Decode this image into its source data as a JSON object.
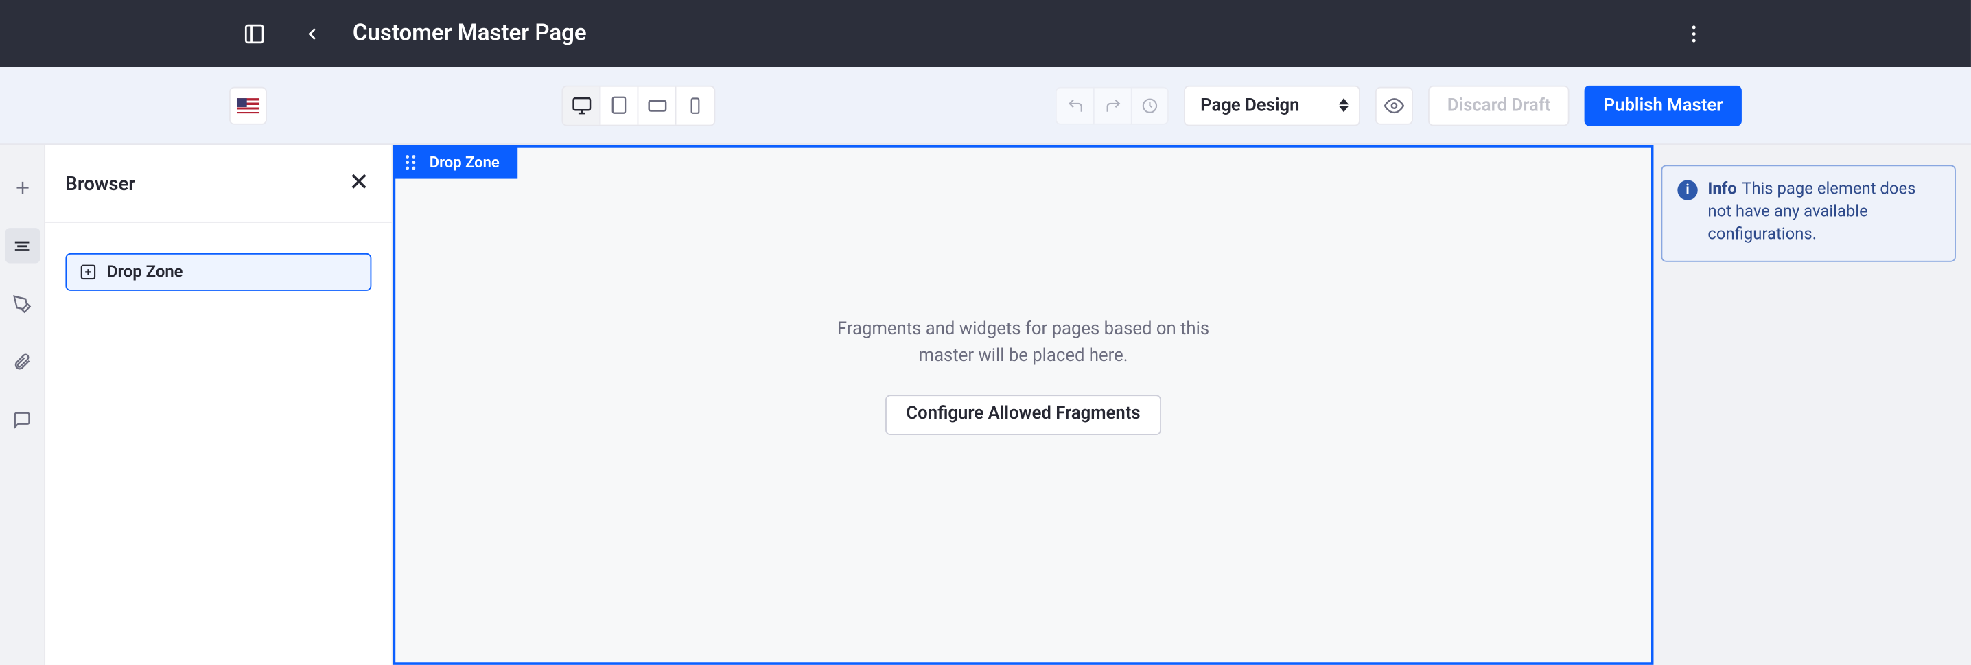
{
  "header": {
    "title": "Customer Master Page"
  },
  "toolbar": {
    "select": {
      "value": "Page Design"
    },
    "discard_label": "Discard Draft",
    "publish_label": "Publish Master"
  },
  "panel": {
    "title": "Browser",
    "tree": {
      "item_label": "Drop Zone"
    }
  },
  "canvas": {
    "drop_zone_label": "Drop Zone",
    "placeholder_text": "Fragments and widgets for pages based on this master will be placed here.",
    "configure_button": "Configure Allowed Fragments"
  },
  "info": {
    "label": "Info",
    "message": "This page element does not have any available configurations."
  }
}
